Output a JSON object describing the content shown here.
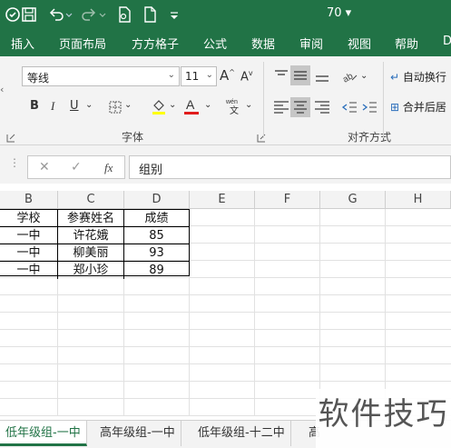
{
  "titlebar": {
    "zoom_label": "70"
  },
  "ribbon_tabs": [
    "插入",
    "页面布局",
    "方方格子",
    "公式",
    "数据",
    "审阅",
    "视图",
    "帮助",
    "D"
  ],
  "font": {
    "name": "等线",
    "size": "11",
    "group_label": "字体"
  },
  "alignment": {
    "wrap_label": "自动换行",
    "merge_label": "合并后居",
    "group_label": "对齐方式"
  },
  "formula_bar": {
    "fx": "fx",
    "value": "组别"
  },
  "columns": [
    "B",
    "C",
    "D",
    "E",
    "F",
    "G",
    "H"
  ],
  "table": {
    "headers": [
      "学校",
      "参赛姓名",
      "成绩"
    ],
    "rows": [
      [
        "一中",
        "许花娥",
        "85"
      ],
      [
        "一中",
        "柳美丽",
        "93"
      ],
      [
        "一中",
        "郑小珍",
        "89"
      ]
    ]
  },
  "sheets": [
    "低年级组-一中",
    "高年级组-一中",
    "低年级组-十二中",
    "高"
  ],
  "watermark": "软件技巧",
  "colors": {
    "brand": "#217346"
  }
}
